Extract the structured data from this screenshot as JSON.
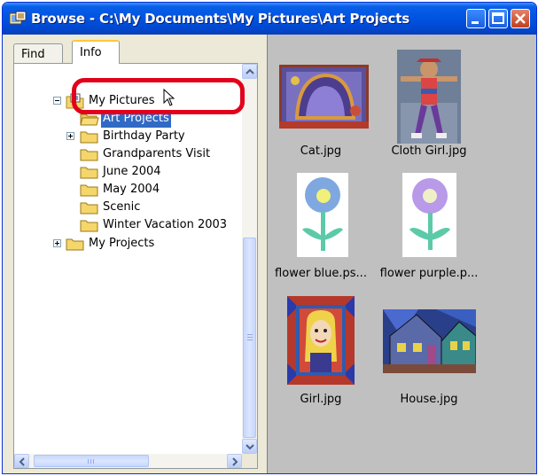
{
  "window": {
    "title": "Browse - C:\\My Documents\\My Pictures\\Art Projects"
  },
  "tabs": [
    {
      "label": "Find",
      "active": false
    },
    {
      "label": "Info",
      "active": true
    }
  ],
  "tree": {
    "root": {
      "label": "My Pictures",
      "expanded": true
    },
    "items": [
      {
        "label": "Art Projects",
        "selected": true
      },
      {
        "label": "Birthday Party",
        "selected": false
      },
      {
        "label": "Grandparents Visit",
        "selected": false
      },
      {
        "label": "June 2004",
        "selected": false
      },
      {
        "label": "May 2004",
        "selected": false
      },
      {
        "label": "Scenic",
        "selected": false
      },
      {
        "label": "Winter Vacation 2003",
        "selected": false
      }
    ],
    "sibling": {
      "label": "My Projects",
      "expanded": false
    }
  },
  "thumbnails": [
    {
      "name": "Cat.jpg",
      "icon": "cat-painting-image"
    },
    {
      "name": "Cloth Girl.jpg",
      "icon": "cloth-girl-image"
    },
    {
      "name": "flower blue.ps...",
      "icon": "blue-flower-image"
    },
    {
      "name": "flower purple.p...",
      "icon": "purple-flower-image"
    },
    {
      "name": "Girl.jpg",
      "icon": "girl-portrait-image"
    },
    {
      "name": "House.jpg",
      "icon": "house-painting-image"
    }
  ],
  "colors": {
    "titlebar": "#0054e3",
    "selection": "#316ac5",
    "highlight_ring": "#e2001a",
    "content_background": "#c0c0c0"
  }
}
